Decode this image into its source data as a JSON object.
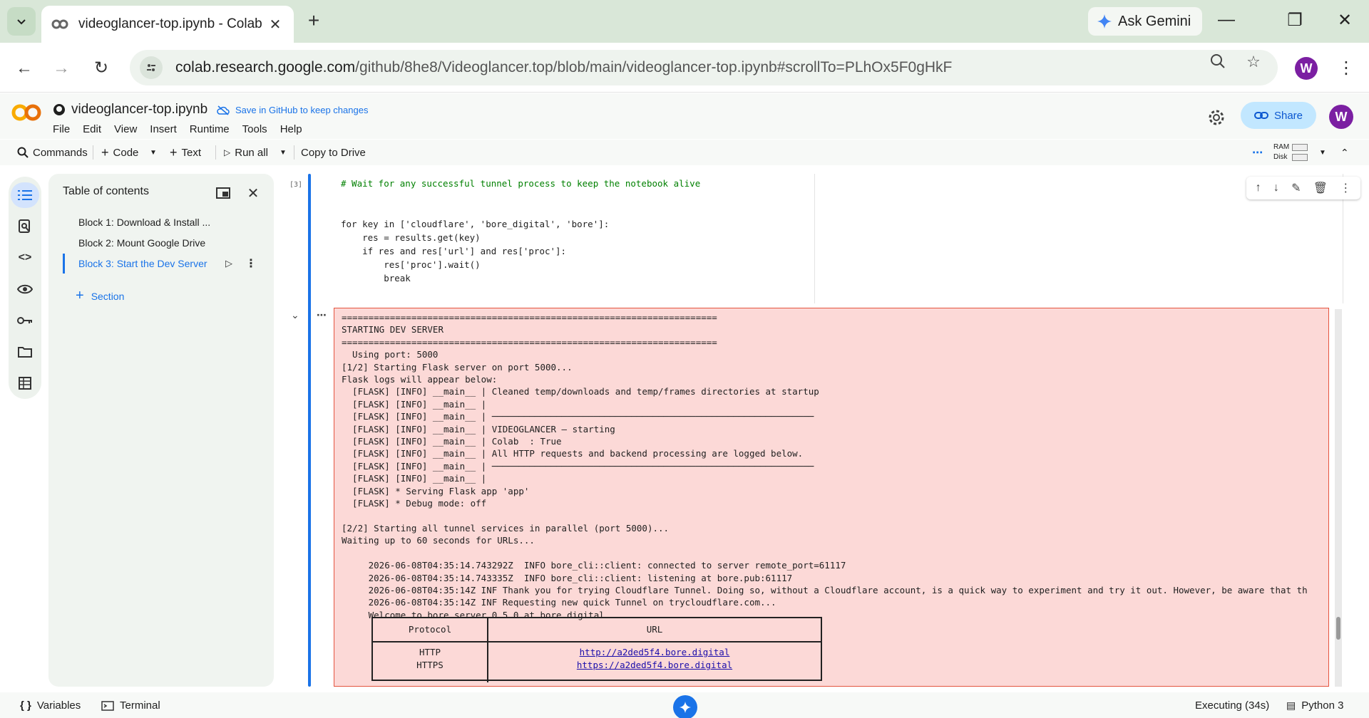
{
  "browser": {
    "tab_title": "videoglancer-top.ipynb - Colab",
    "gemini_label": "Ask Gemini",
    "url_host": "colab.research.google.com",
    "url_path": "/github/8he8/Videoglancer.top/blob/main/videoglancer-top.ipynb#scrollTo=PLhOx5F0gHkF",
    "profile_initial": "W"
  },
  "colab": {
    "notebook_title": "videoglancer-top.ipynb",
    "save_github": "Save in GitHub to keep changes",
    "menu": [
      "File",
      "Edit",
      "View",
      "Insert",
      "Runtime",
      "Tools",
      "Help"
    ],
    "share_label": "Share",
    "profile_initial": "W",
    "toolbar": {
      "commands": "Commands",
      "code": "Code",
      "text": "Text",
      "run_all": "Run all",
      "copy_drive": "Copy to Drive",
      "ram": "RAM",
      "disk": "Disk"
    }
  },
  "toc": {
    "title": "Table of contents",
    "items": [
      "Block 1: Download & Install ...",
      "Block 2: Mount Google Drive",
      "Block 3: Start the Dev Server"
    ],
    "section_label": "Section"
  },
  "cell": {
    "exec_count": "[3]",
    "code_lines": [
      "# Wait for any successful tunnel process to keep the notebook alive",
      "",
      "",
      "for key in ['cloudflare', 'bore_digital', 'bore']:",
      "    res = results.get(key)",
      "    if res and res['url'] and res['proc']:",
      "        res['proc'].wait()",
      "        break"
    ],
    "output_lines": [
      "======================================================================",
      "STARTING DEV SERVER",
      "======================================================================",
      "  Using port: 5000",
      "[1/2] Starting Flask server on port 5000...",
      "Flask logs will appear below:",
      "  [FLASK] [INFO] __main__ | Cleaned temp/downloads and temp/frames directories at startup",
      "  [FLASK] [INFO] __main__ |",
      "  [FLASK] [INFO] __main__ | ────────────────────────────────────────────────────────────",
      "  [FLASK] [INFO] __main__ | VIDEOGLANCER — starting",
      "  [FLASK] [INFO] __main__ | Colab  : True",
      "  [FLASK] [INFO] __main__ | All HTTP requests and backend processing are logged below.",
      "  [FLASK] [INFO] __main__ | ────────────────────────────────────────────────────────────",
      "  [FLASK] [INFO] __main__ |",
      "  [FLASK] * Serving Flask app 'app'",
      "  [FLASK] * Debug mode: off",
      "",
      "[2/2] Starting all tunnel services in parallel (port 5000)...",
      "Waiting up to 60 seconds for URLs...",
      "",
      "     2026-06-08T04:35:14.743292Z  INFO bore_cli::client: connected to server remote_port=61117",
      "     2026-06-08T04:35:14.743335Z  INFO bore_cli::client: listening at bore.pub:61117",
      "     2026-06-08T04:35:14Z INF Thank you for trying Cloudflare Tunnel. Doing so, without a Cloudflare account, is a quick way to experiment and try it out. However, be aware that th",
      "     2026-06-08T04:35:14Z INF Requesting new quick Tunnel on trycloudflare.com...",
      "     Welcome to bore server 0.5.0 at bore.digital"
    ],
    "table": {
      "headers": [
        "Protocol",
        "URL"
      ],
      "rows": [
        {
          "protocol": "HTTP",
          "url": "http://a2ded5f4.bore.digital"
        },
        {
          "protocol": "HTTPS",
          "url": "https://a2ded5f4.bore.digital"
        }
      ]
    }
  },
  "status": {
    "variables": "Variables",
    "terminal": "Terminal",
    "executing": "Executing (34s)",
    "runtime": "Python 3"
  }
}
